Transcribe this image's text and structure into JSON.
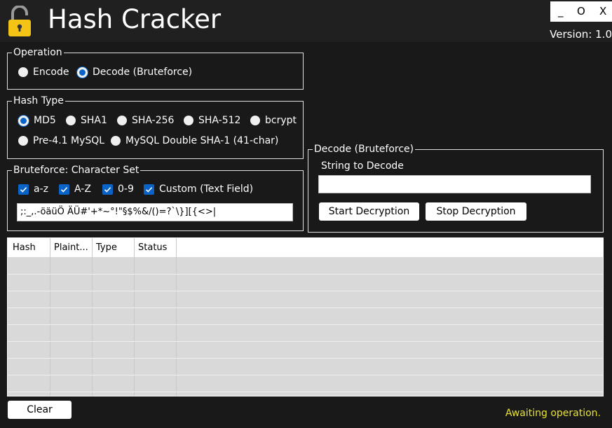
{
  "window": {
    "title": "Hash Cracker",
    "version": "Version: 1.0",
    "controls": {
      "minimize": "_",
      "maximize": "O",
      "close": "X"
    }
  },
  "operation": {
    "legend": "Operation",
    "options": [
      {
        "label": "Encode",
        "selected": false
      },
      {
        "label": "Decode (Bruteforce)",
        "selected": true
      }
    ]
  },
  "hash_type": {
    "legend": "Hash Type",
    "options": [
      {
        "label": "MD5",
        "selected": true
      },
      {
        "label": "SHA1",
        "selected": false
      },
      {
        "label": "SHA-256",
        "selected": false
      },
      {
        "label": "SHA-512",
        "selected": false
      },
      {
        "label": "bcrypt",
        "selected": false
      },
      {
        "label": "Pre-4.1 MySQL",
        "selected": false
      },
      {
        "label": "MySQL Double SHA-1 (41-char)",
        "selected": false
      }
    ]
  },
  "charset": {
    "legend": "Bruteforce: Character Set",
    "options": [
      {
        "label": "a-z",
        "checked": true
      },
      {
        "label": "A-Z",
        "checked": true
      },
      {
        "label": "0-9",
        "checked": true
      },
      {
        "label": "Custom (Text Field)",
        "checked": true
      }
    ],
    "custom_value": ";:_,.-öäüÖ ÄÜ#'+*~°!\"§$%&/()=?`\\}][{<>|"
  },
  "decode": {
    "legend": "Decode (Bruteforce)",
    "field_label": "String to Decode",
    "field_value": "",
    "start_label": "Start Decryption",
    "stop_label": "Stop Decryption"
  },
  "results": {
    "columns": [
      "Hash",
      "Plaint...",
      "Type",
      "Status"
    ],
    "rows": []
  },
  "footer": {
    "clear_label": "Clear",
    "status_text": "Awaiting operation."
  },
  "colors": {
    "background": "#191919",
    "titlebar": "#202020",
    "accent": "#0a64c8",
    "status": "#e8e234",
    "grid_body": "#d9d9d9"
  },
  "icons": {
    "app": "padlock-open-icon",
    "check": "checkmark-icon"
  }
}
